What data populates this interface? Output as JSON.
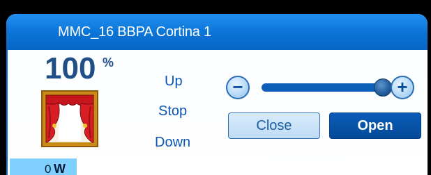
{
  "window": {
    "title": "MMC_16 BBPA Cortina 1"
  },
  "status": {
    "position_value": "100",
    "position_unit": "%",
    "power_value": "0",
    "power_unit": "W"
  },
  "commands": {
    "up": "Up",
    "stop": "Stop",
    "down": "Down"
  },
  "slider": {
    "level_percent": 100,
    "decrease_glyph": "−",
    "increase_glyph": "+"
  },
  "buttons": {
    "close_label": "Close",
    "open_label": "Open"
  },
  "icons": {
    "device_icon": "curtain-icon",
    "decrease_icon": "minus-icon",
    "increase_icon": "plus-icon"
  },
  "colors": {
    "titlebar": "#0b73d6",
    "accent": "#0a5cb8",
    "power_bar": "#7fd0ff",
    "text_blue": "#1f4f86"
  }
}
